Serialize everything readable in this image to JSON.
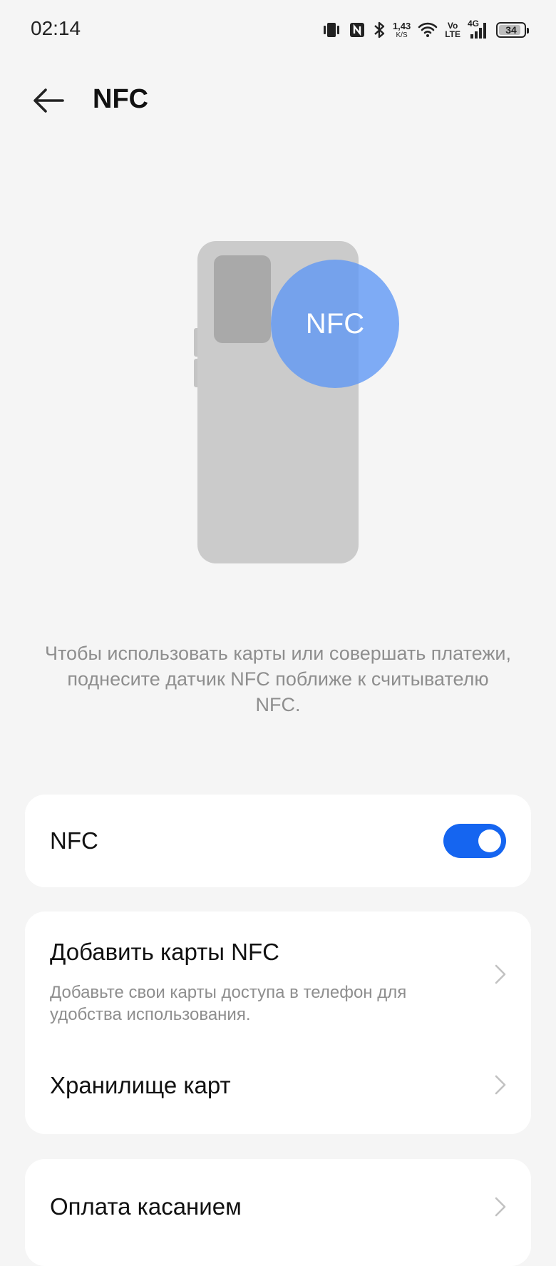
{
  "status_bar": {
    "time": "02:14",
    "net_speed_value": "1,43",
    "net_speed_unit": "K/S",
    "volte_top": "Vo",
    "volte_bottom": "LTE",
    "network_type": "4G",
    "battery_percent": "34",
    "icons": [
      "vibrate-icon",
      "nfc-status-icon",
      "bluetooth-icon",
      "wifi-icon",
      "volte-icon",
      "signal-icon",
      "battery-icon"
    ]
  },
  "header": {
    "title": "NFC",
    "back_icon": "arrow-left-icon"
  },
  "illustration": {
    "circle_label": "NFC"
  },
  "instruction": "Чтобы использовать карты или совершать платежи, поднесите датчик NFC поближе к считывателю NFC.",
  "nfc_card": {
    "label": "NFC",
    "toggle_on": true
  },
  "cards_group": {
    "items": [
      {
        "title": "Добавить карты NFC",
        "subtitle": "Добавьте свои карты доступа в телефон для удобства использования."
      },
      {
        "title": "Хранилище карт"
      }
    ]
  },
  "payment_group": {
    "items": [
      {
        "title": "Оплата касанием"
      }
    ]
  },
  "colors": {
    "accent": "#1565f0",
    "background": "#f5f5f5",
    "nfc_circle": "#5c96f5"
  }
}
